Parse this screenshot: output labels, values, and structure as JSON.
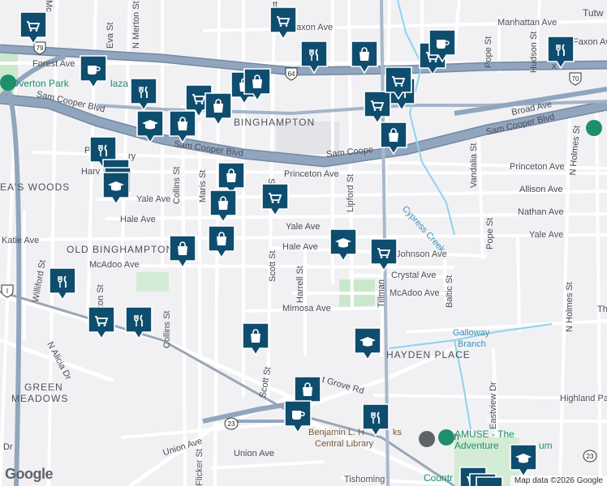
{
  "map": {
    "districts": [
      {
        "id": "binghampton",
        "text": "BINGHAMPTON"
      },
      {
        "id": "old-binghampton",
        "text": "OLD BINGHAMPTON"
      },
      {
        "id": "rea-woods",
        "text": "EA'S WOODS"
      },
      {
        "id": "green-meadows-1",
        "text": "GREEN"
      },
      {
        "id": "green-meadows-2",
        "text": "MEADOWS"
      },
      {
        "id": "hayden-place",
        "text": "HAYDEN PLACE"
      }
    ],
    "streets": {
      "forest_ave": "Forest Ave",
      "faxon_ave_left": "axon Ave",
      "faxon_ave_right": "Faxon Ave",
      "manhattan_ave": "Manhattan Ave",
      "tutwiler": "Tutw",
      "sam_cooper_left": "Sam Cooper Blvd",
      "sam_cooper_mid": "Sam Cooper Blvd",
      "sam_cooper_mid2": "Sam Coope",
      "sam_cooper_right": "Sam Cooper Blvd",
      "broad_ave": "Broad Ave",
      "princeton_ave": "Princeton Ave",
      "princeton_ave_right": "Princeton Ave",
      "allison_ave": "Allison Ave",
      "nathan_ave": "Nathan Ave",
      "yale_ave_left": "Yale Ave",
      "yale_ave_mid": "Yale Ave",
      "yale_ave_right": "Yale Ave",
      "hale_ave_left": "Hale Ave",
      "hale_ave_mid": "Hale Ave",
      "johnson_ave": "Johnson Ave",
      "crystal_ave": "Crystal Ave",
      "mcadoo_ave_left": "McAdoo Ave",
      "mcadoo_ave_right": "McAdoo Ave",
      "mimosa_ave": "Mimosa Ave",
      "katie_ave": "Katie Ave",
      "harvard_ave": "Harv",
      "park_ave": "P",
      "highland_park": "Highland Park",
      "union_ave": "Union Ave",
      "union_ave_2": "Union Ave",
      "summer_grove_rd": "t Grove Rd",
      "tishomingo": "Tishoming",
      "scott_st_top": "Scott St",
      "scott_st_mid": "Scott St",
      "scott_st_bottom": "Scott St",
      "collins_st": "Collins St",
      "maris_st": "Maris St",
      "merton_st": "N Merton St",
      "eva_st": "Eva St",
      "mc_st": "Mc",
      "lipford_st": "Lipford St",
      "harrell_st": "Harrell St",
      "tillman_st": "Tillman",
      "pope_st_top": "Pope St",
      "pope_st_mid": "Pope St",
      "hudson_st": "Hudson St",
      "vandalia_st": "Vandalia St",
      "n_holmes_top": "N Holmes St",
      "n_holmes_bottom": "N Holmes St",
      "baltic_st": "Baltic St",
      "eastview_dr": "Eastview Dr",
      "williford_st": "Williford St",
      "alicia_dr": "N Alicia Dr",
      "flicker_st": "Flicker St",
      "ton_st": "ton St",
      "dr_label": "Dr",
      "ry_label": "ry",
      "th_label": "Th",
      "ch_label": "ch",
      "tt_label": "tt",
      "x_label": "x"
    },
    "water": {
      "cypress_creek": "Cypress Creek",
      "galloway_branch_1": "Galloway",
      "galloway_branch_2": "Branch"
    },
    "places": {
      "overton_park_plaza": "Overton Park",
      "plaza_suffix": "laza",
      "library_1": "Benjamin L. H",
      "library_1b": "ks",
      "library_2": "Central Library",
      "amuse_1": "AMUSE - The",
      "amuse_2": "Adventure",
      "amuse_2b": "um",
      "country": "Countr"
    },
    "shields": {
      "us79": "79",
      "us64": "64",
      "us70": "70",
      "sr23_a": "23",
      "sr23_b": "23",
      "hw_left": "I"
    },
    "pins": [
      {
        "type": "grocery",
        "icon": "shopping-cart-icon"
      },
      {
        "type": "grocery",
        "icon": "shopping-cart-icon"
      },
      {
        "type": "cafe",
        "icon": "coffee-cup-icon"
      },
      {
        "type": "restaurant",
        "icon": "fork-knife-icon"
      },
      {
        "type": "shop",
        "icon": "shopping-bag-icon"
      },
      {
        "type": "grocery",
        "icon": "shopping-cart-icon"
      },
      {
        "type": "cafe",
        "icon": "coffee-cup-icon"
      },
      {
        "type": "grocery",
        "icon": "shopping-cart-icon"
      },
      {
        "type": "restaurant",
        "icon": "fork-knife-icon"
      },
      {
        "type": "restaurant",
        "icon": "fork-knife-icon"
      },
      {
        "type": "shop",
        "icon": "shopping-bag-icon"
      },
      {
        "type": "shop",
        "icon": "shopping-bag-icon"
      },
      {
        "type": "grocery",
        "icon": "shopping-cart-icon"
      },
      {
        "type": "shop",
        "icon": "shopping-bag-icon"
      },
      {
        "type": "school",
        "icon": "graduation-cap-icon"
      },
      {
        "type": "shop",
        "icon": "shopping-bag-icon"
      },
      {
        "type": "grocery",
        "icon": "shopping-cart-icon"
      },
      {
        "type": "restaurant",
        "icon": "fork-knife-icon"
      },
      {
        "type": "restaurant",
        "icon": "fork-knife-icon"
      },
      {
        "type": "shop",
        "icon": "shopping-bag-icon"
      },
      {
        "type": "school",
        "icon": "graduation-cap-icon"
      },
      {
        "type": "school",
        "icon": "graduation-cap-icon"
      },
      {
        "type": "shop",
        "icon": "shopping-bag-icon"
      },
      {
        "type": "shop",
        "icon": "shopping-bag-icon"
      },
      {
        "type": "grocery",
        "icon": "shopping-cart-icon"
      },
      {
        "type": "shop",
        "icon": "shopping-bag-icon"
      },
      {
        "type": "shop",
        "icon": "shopping-bag-icon"
      },
      {
        "type": "school",
        "icon": "graduation-cap-icon"
      },
      {
        "type": "grocery",
        "icon": "shopping-cart-icon"
      },
      {
        "type": "restaurant",
        "icon": "fork-knife-icon"
      },
      {
        "type": "grocery",
        "icon": "shopping-cart-icon"
      },
      {
        "type": "restaurant",
        "icon": "fork-knife-icon"
      },
      {
        "type": "shop",
        "icon": "shopping-bag-icon"
      },
      {
        "type": "school",
        "icon": "graduation-cap-icon"
      },
      {
        "type": "shop",
        "icon": "shopping-bag-icon"
      },
      {
        "type": "cafe",
        "icon": "coffee-cup-icon"
      },
      {
        "type": "restaurant",
        "icon": "fork-knife-icon"
      },
      {
        "type": "restaurant",
        "icon": "fork-knife-icon"
      },
      {
        "type": "school",
        "icon": "graduation-cap-icon"
      },
      {
        "type": "grocery",
        "icon": "shopping-cart-icon"
      },
      {
        "type": "grocery",
        "icon": "shopping-cart-icon"
      },
      {
        "type": "grocery",
        "icon": "shopping-cart-icon"
      }
    ],
    "attribution": "Map data ©2026 Google",
    "logo": "Google",
    "colors": {
      "pin": "#0f4d6e",
      "highway": "#8fa4bd",
      "highway_outline": "#7389a3",
      "street": "#ffffff",
      "park": "#c9e8cc",
      "water": "#8fd2ec",
      "land": "#f1f1f4"
    }
  }
}
